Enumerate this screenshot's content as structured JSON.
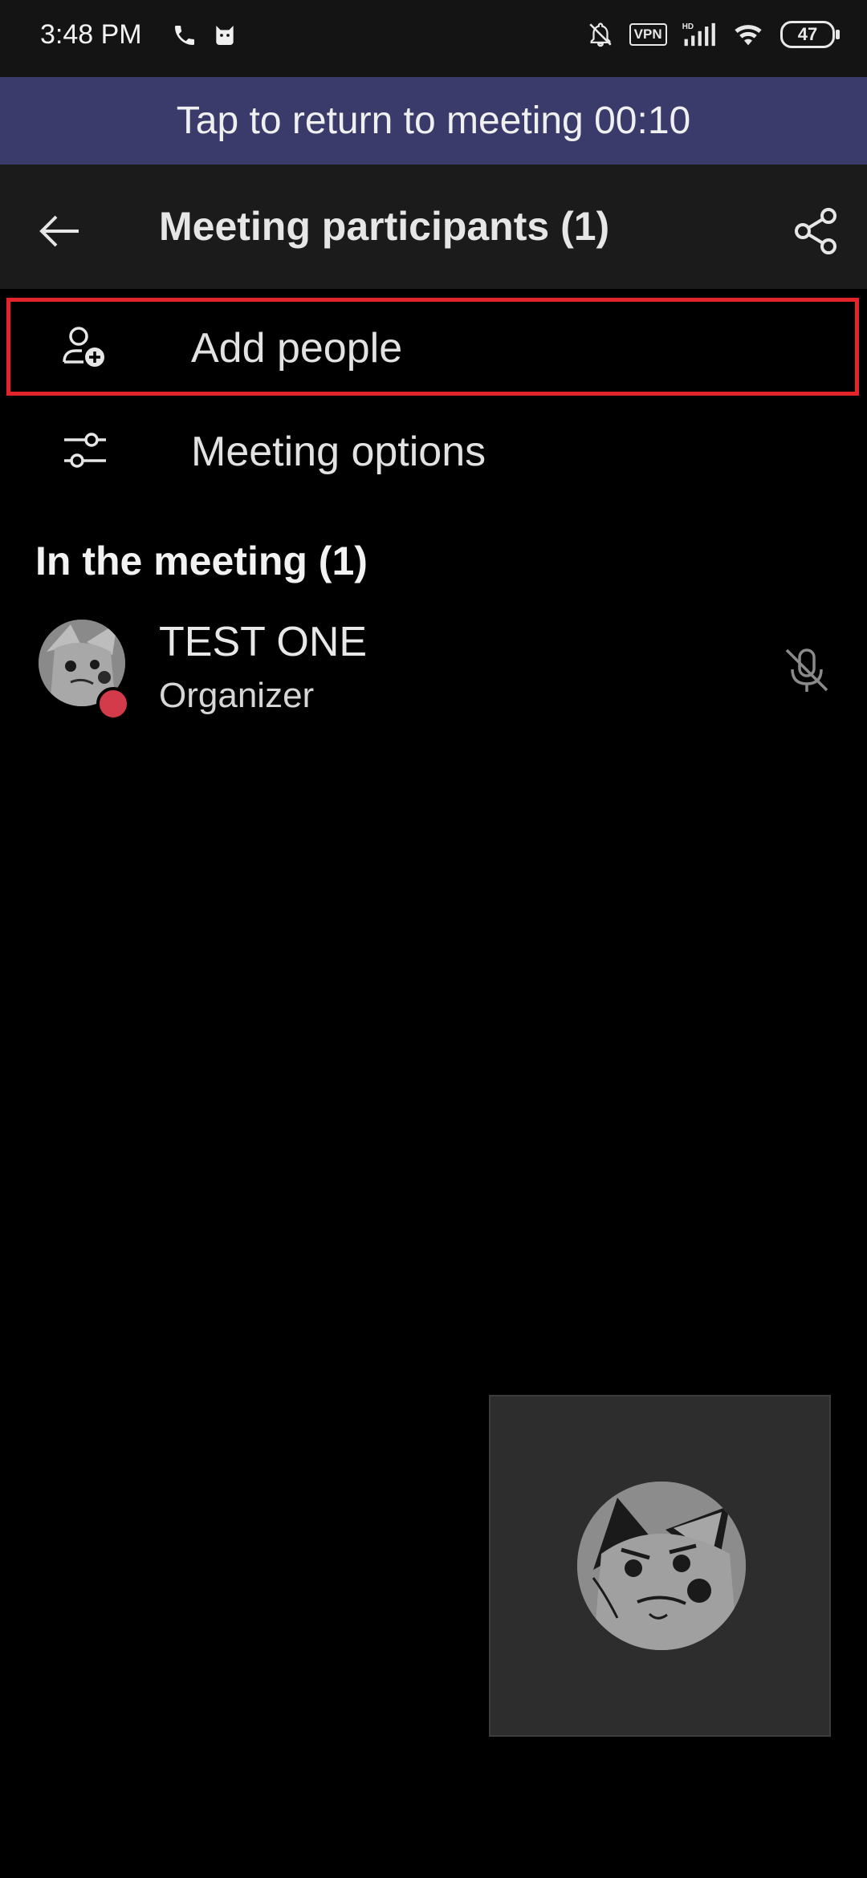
{
  "status_bar": {
    "time": "3:48 PM",
    "vpn_label": "VPN",
    "battery": "47",
    "icons": [
      "phone-icon",
      "cat-app-icon",
      "bell-off-icon",
      "vpn-icon",
      "hd-signal-icon",
      "wifi-icon",
      "battery-icon"
    ]
  },
  "banner": {
    "text": "Tap to return to meeting 00:10"
  },
  "header": {
    "title": "Meeting participants (1)",
    "back_icon": "arrow-left-icon",
    "share_icon": "share-icon"
  },
  "options": [
    {
      "label": "Add people",
      "icon": "person-add-icon"
    },
    {
      "label": "Meeting options",
      "icon": "sliders-icon"
    }
  ],
  "section": {
    "title": "In the meeting (1)"
  },
  "participants": [
    {
      "name": "TEST ONE",
      "role": "Organizer",
      "status_color": "#d33a4a",
      "mic": "mic-off-icon"
    }
  ],
  "colors": {
    "banner_bg": "#3b3b6b",
    "header_bg": "#1b1b1b",
    "highlight": "#e3242b",
    "status_busy": "#d33a4a"
  }
}
